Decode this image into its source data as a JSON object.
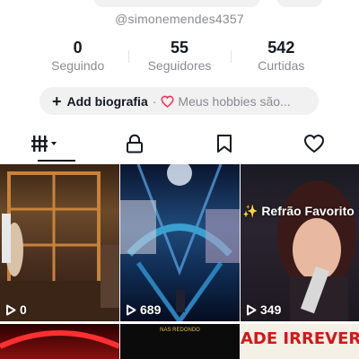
{
  "profile": {
    "username": "@simonemendes4357"
  },
  "stats": [
    {
      "value": "0",
      "label": "Seguindo"
    },
    {
      "value": "55",
      "label": "Seguidores"
    },
    {
      "value": "542",
      "label": "Curtidas"
    }
  ],
  "bio": {
    "add_label": "Add biografia",
    "separator": "·",
    "hobbies_label": "Meus hobbies são..."
  },
  "tabs": [
    {
      "icon": "grid-videos-icon",
      "active": true
    },
    {
      "icon": "lock-icon",
      "active": false
    },
    {
      "icon": "bookmark-icon",
      "active": false
    },
    {
      "icon": "heart-icon",
      "active": false
    }
  ],
  "videos": [
    {
      "views": "0"
    },
    {
      "views": "689"
    },
    {
      "views": "349",
      "overlay_text": "✨ Refrão Favorito"
    },
    {},
    {
      "overlay_text": "NAS REDONDO"
    },
    {
      "overlay_text": "ADE IRREVER"
    }
  ],
  "colors": {
    "text_primary": "#161823",
    "text_secondary": "#8a8b91",
    "pill_bg": "#f1f1f2",
    "heart_red": "#fe2c55"
  }
}
